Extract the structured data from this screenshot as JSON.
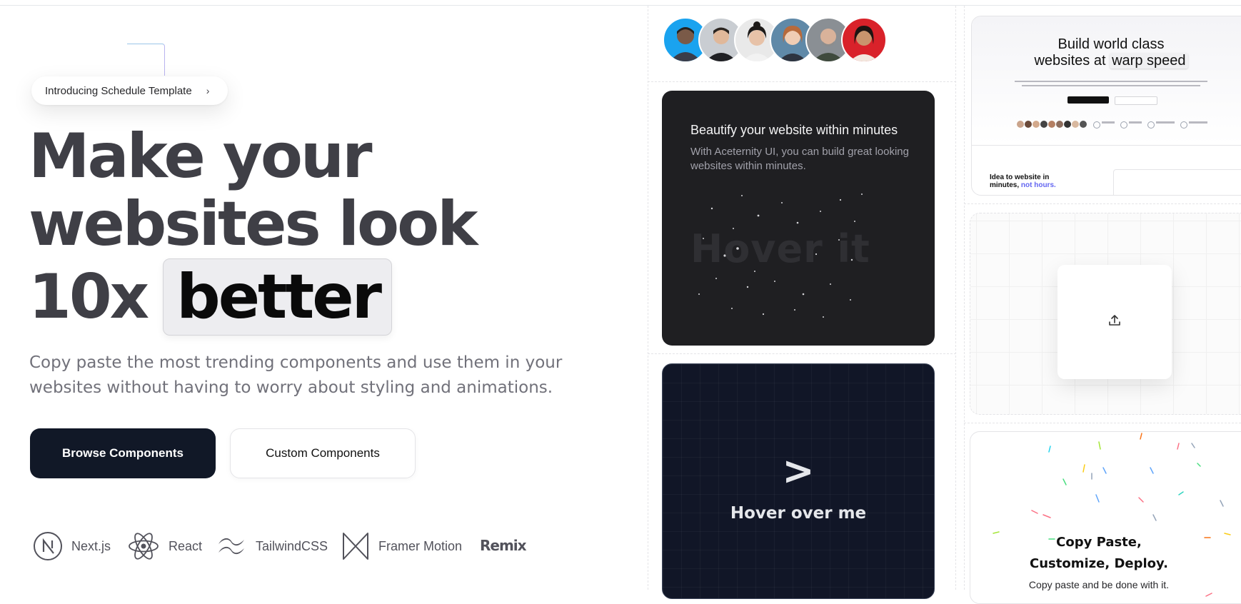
{
  "hero": {
    "announcement": "Introducing Schedule Template",
    "announcement_arrow": "›",
    "headline_line1": "Make your",
    "headline_line2": "websites look",
    "headline_line3": "10x",
    "headline_highlight": "better",
    "subtitle": "Copy paste the most trending components and use them in your websites without having to worry about styling and animations.",
    "primary_button": "Browse Components",
    "secondary_button": "Custom Components"
  },
  "tech_stack": [
    {
      "label": "Next.js",
      "icon": "nextjs-icon"
    },
    {
      "label": "React",
      "icon": "react-icon"
    },
    {
      "label": "TailwindCSS",
      "icon": "tailwind-icon"
    },
    {
      "label": "Framer Motion",
      "icon": "framer-motion-icon"
    },
    {
      "label": "Remix",
      "icon": "remix-logo"
    }
  ],
  "avatars": {
    "count": 6
  },
  "sparkle_card": {
    "title": "Beautify your website within minutes",
    "description": "With Aceternity UI, you can build great looking websites within minutes.",
    "overlay_text": "Hover it"
  },
  "hover_card": {
    "glyph": ">",
    "label": "Hover over me"
  },
  "mock_site": {
    "headline_line1": "Build world class",
    "headline_line2_prefix": "websites at",
    "headline_highlight": "warp speed",
    "section_title_prefix": "Idea to website in",
    "section_title_mid": "minutes,",
    "section_title_accent": "not hours."
  },
  "upload_card": {
    "icon": "upload-icon"
  },
  "copy_card": {
    "title_line1": "Copy Paste,",
    "title_line2": "Customize, Deploy.",
    "description": "Copy paste and be done with it."
  },
  "colors": {
    "primary_button_bg": "#111827",
    "headline": "#3f3f46",
    "subtitle": "#71717a",
    "dark_card": "#1f1f22",
    "hover_card": "#111627"
  }
}
